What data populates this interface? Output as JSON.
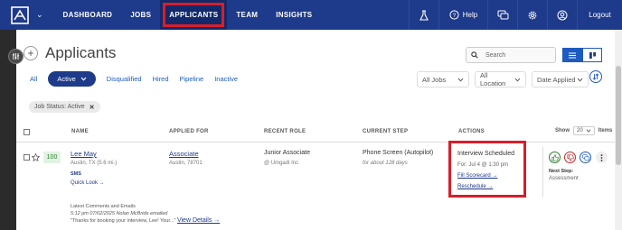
{
  "nav": {
    "links": [
      "DASHBOARD",
      "JOBS",
      "APPLICANTS",
      "TEAM",
      "INSIGHTS"
    ],
    "help_label": "Help",
    "logout_label": "Logout",
    "brand_color": "#1e3a8a",
    "highlight_color": "#d81e2a"
  },
  "header": {
    "title": "Applicants",
    "add_icon": "plus-icon"
  },
  "search": {
    "placeholder": "Search"
  },
  "tabs": [
    "All",
    "Active",
    "Disqualified",
    "Hired",
    "Pipeline",
    "Inactive"
  ],
  "filters": {
    "jobs": "All Jobs",
    "location": "All Location",
    "date": "Date Applied"
  },
  "chip": {
    "label": "Job Status: Active",
    "remove": "✕"
  },
  "table": {
    "headers": [
      "NAME",
      "APPLIED FOR",
      "RECENT ROLE",
      "CURRENT STEP",
      "ACTIONS"
    ],
    "show_label": "Show",
    "show_value": "20",
    "items_label": "Items"
  },
  "row": {
    "score": "100",
    "name": "Lee May",
    "location": "Austin, TX (5.6 mi.)",
    "sms": "SMS",
    "quick_look": "Quick Look →",
    "applied_for": "Associate",
    "applied_location": "Austin, 78701",
    "recent_role": "Junior Associate",
    "recent_company": "@ Umgadi Inc",
    "step": "Phone Screen (Autopilot)",
    "step_age": "for about 128 days",
    "action_title": "Interview Scheduled",
    "action_date": "For: Jul 4 @ 1:30 pm",
    "fill_scorecard": "Fill Scorecard →",
    "reschedule": "Reschedule →",
    "next_step_label": "Next Step:",
    "next_step": "Assessment",
    "comments_title": "Latest Comments and Emails",
    "comment_meta": "5:12 pm 07/02/2025 Nolan McBride emailed",
    "comment_text": "\"Thanks for booking your interview, Lee! Your...\"",
    "view_details": "View Details →"
  }
}
